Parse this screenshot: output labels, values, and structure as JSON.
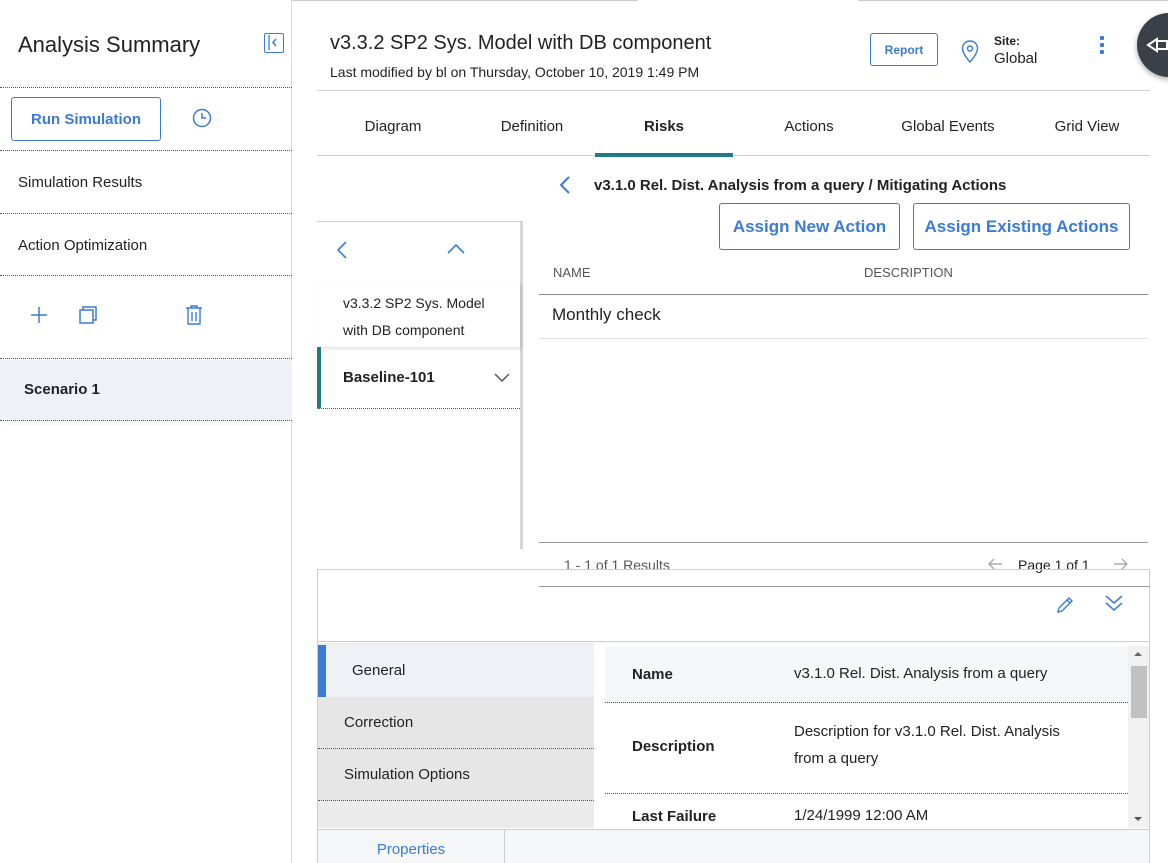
{
  "sidebar": {
    "title": "Analysis Summary",
    "run_simulation": "Run Simulation",
    "items": [
      "Simulation Results",
      "Action Optimization"
    ],
    "scenario": "Scenario 1"
  },
  "header": {
    "title": "v3.3.2 SP2 Sys. Model with DB component",
    "subtitle": "Last modified by bl on Thursday, October 10, 2019 1:49 PM",
    "report": "Report",
    "site_label": "Site:",
    "site_value": "Global"
  },
  "tabs": [
    "Diagram",
    "Definition",
    "Risks",
    "Actions",
    "Global Events",
    "Grid View"
  ],
  "active_tab": "Risks",
  "tree": {
    "item1": "v3.3.2 SP2 Sys. Model with DB component",
    "item2": "Baseline-101"
  },
  "actions_panel": {
    "breadcrumb": "v3.1.0 Rel. Dist. Analysis from a query / Mitigating Actions",
    "assign_new": "Assign New Action",
    "assign_existing": "Assign Existing Actions",
    "columns": [
      "NAME",
      "DESCRIPTION"
    ],
    "rows": [
      {
        "name": "Monthly check",
        "description": ""
      }
    ],
    "results": "1 - 1 of 1 Results",
    "page": "Page 1 of 1"
  },
  "properties": {
    "sections": [
      "General",
      "Correction",
      "Simulation Options"
    ],
    "active_section": "General",
    "fields": [
      {
        "key": "Name",
        "value": "v3.1.0 Rel. Dist. Analysis from a query"
      },
      {
        "key": "Description",
        "value": "Description for v3.1.0 Rel. Dist. Analysis from a query"
      },
      {
        "key": "Last Failure",
        "value": "1/24/1999 12:00 AM"
      }
    ],
    "footer_tab": "Properties"
  },
  "colors": {
    "accent": "#3a7bd5",
    "active_tab": "#1f7a86"
  }
}
